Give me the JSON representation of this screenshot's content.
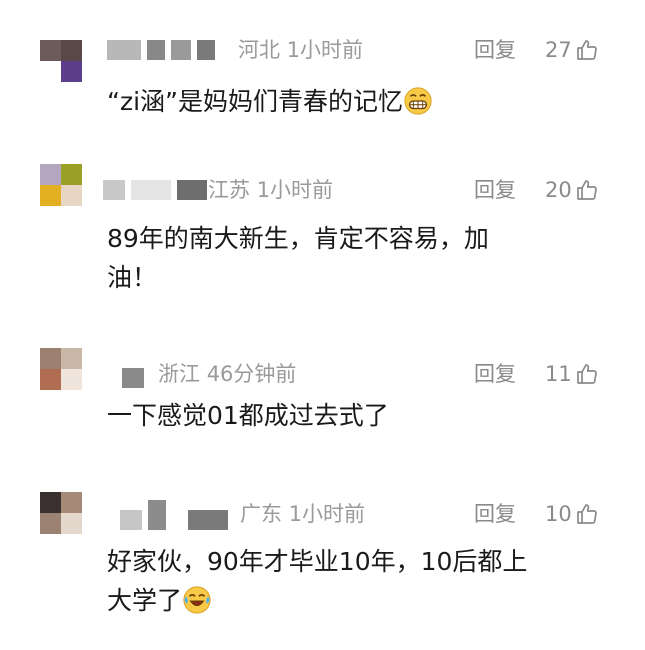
{
  "comments": [
    {
      "location": "河北",
      "time": "1小时前",
      "reply_label": "回复",
      "likes": "27",
      "text": "“zi涵”是妈妈们青春的记忆",
      "emoji": "grinning-face"
    },
    {
      "location": "江苏",
      "time": "1小时前",
      "reply_label": "回复",
      "likes": "20",
      "text_line1": "89年的南大新生，肯定不容易，加",
      "text_line2": "油！"
    },
    {
      "location": "浙江",
      "time": "46分钟前",
      "reply_label": "回复",
      "likes": "11",
      "text": "一下感觉01都成过去式了"
    },
    {
      "location": "广东",
      "time": "1小时前",
      "reply_label": "回复",
      "likes": "10",
      "text_line1": "好家伙，90年才毕业10年，10后都上",
      "text_line2": "大学了",
      "emoji": "laughing-crying-face"
    }
  ],
  "icons": {
    "like": "thumbs-up-icon"
  },
  "colors": {
    "meta_text": "#9a9a9a",
    "body_text": "#1a1a1a"
  }
}
